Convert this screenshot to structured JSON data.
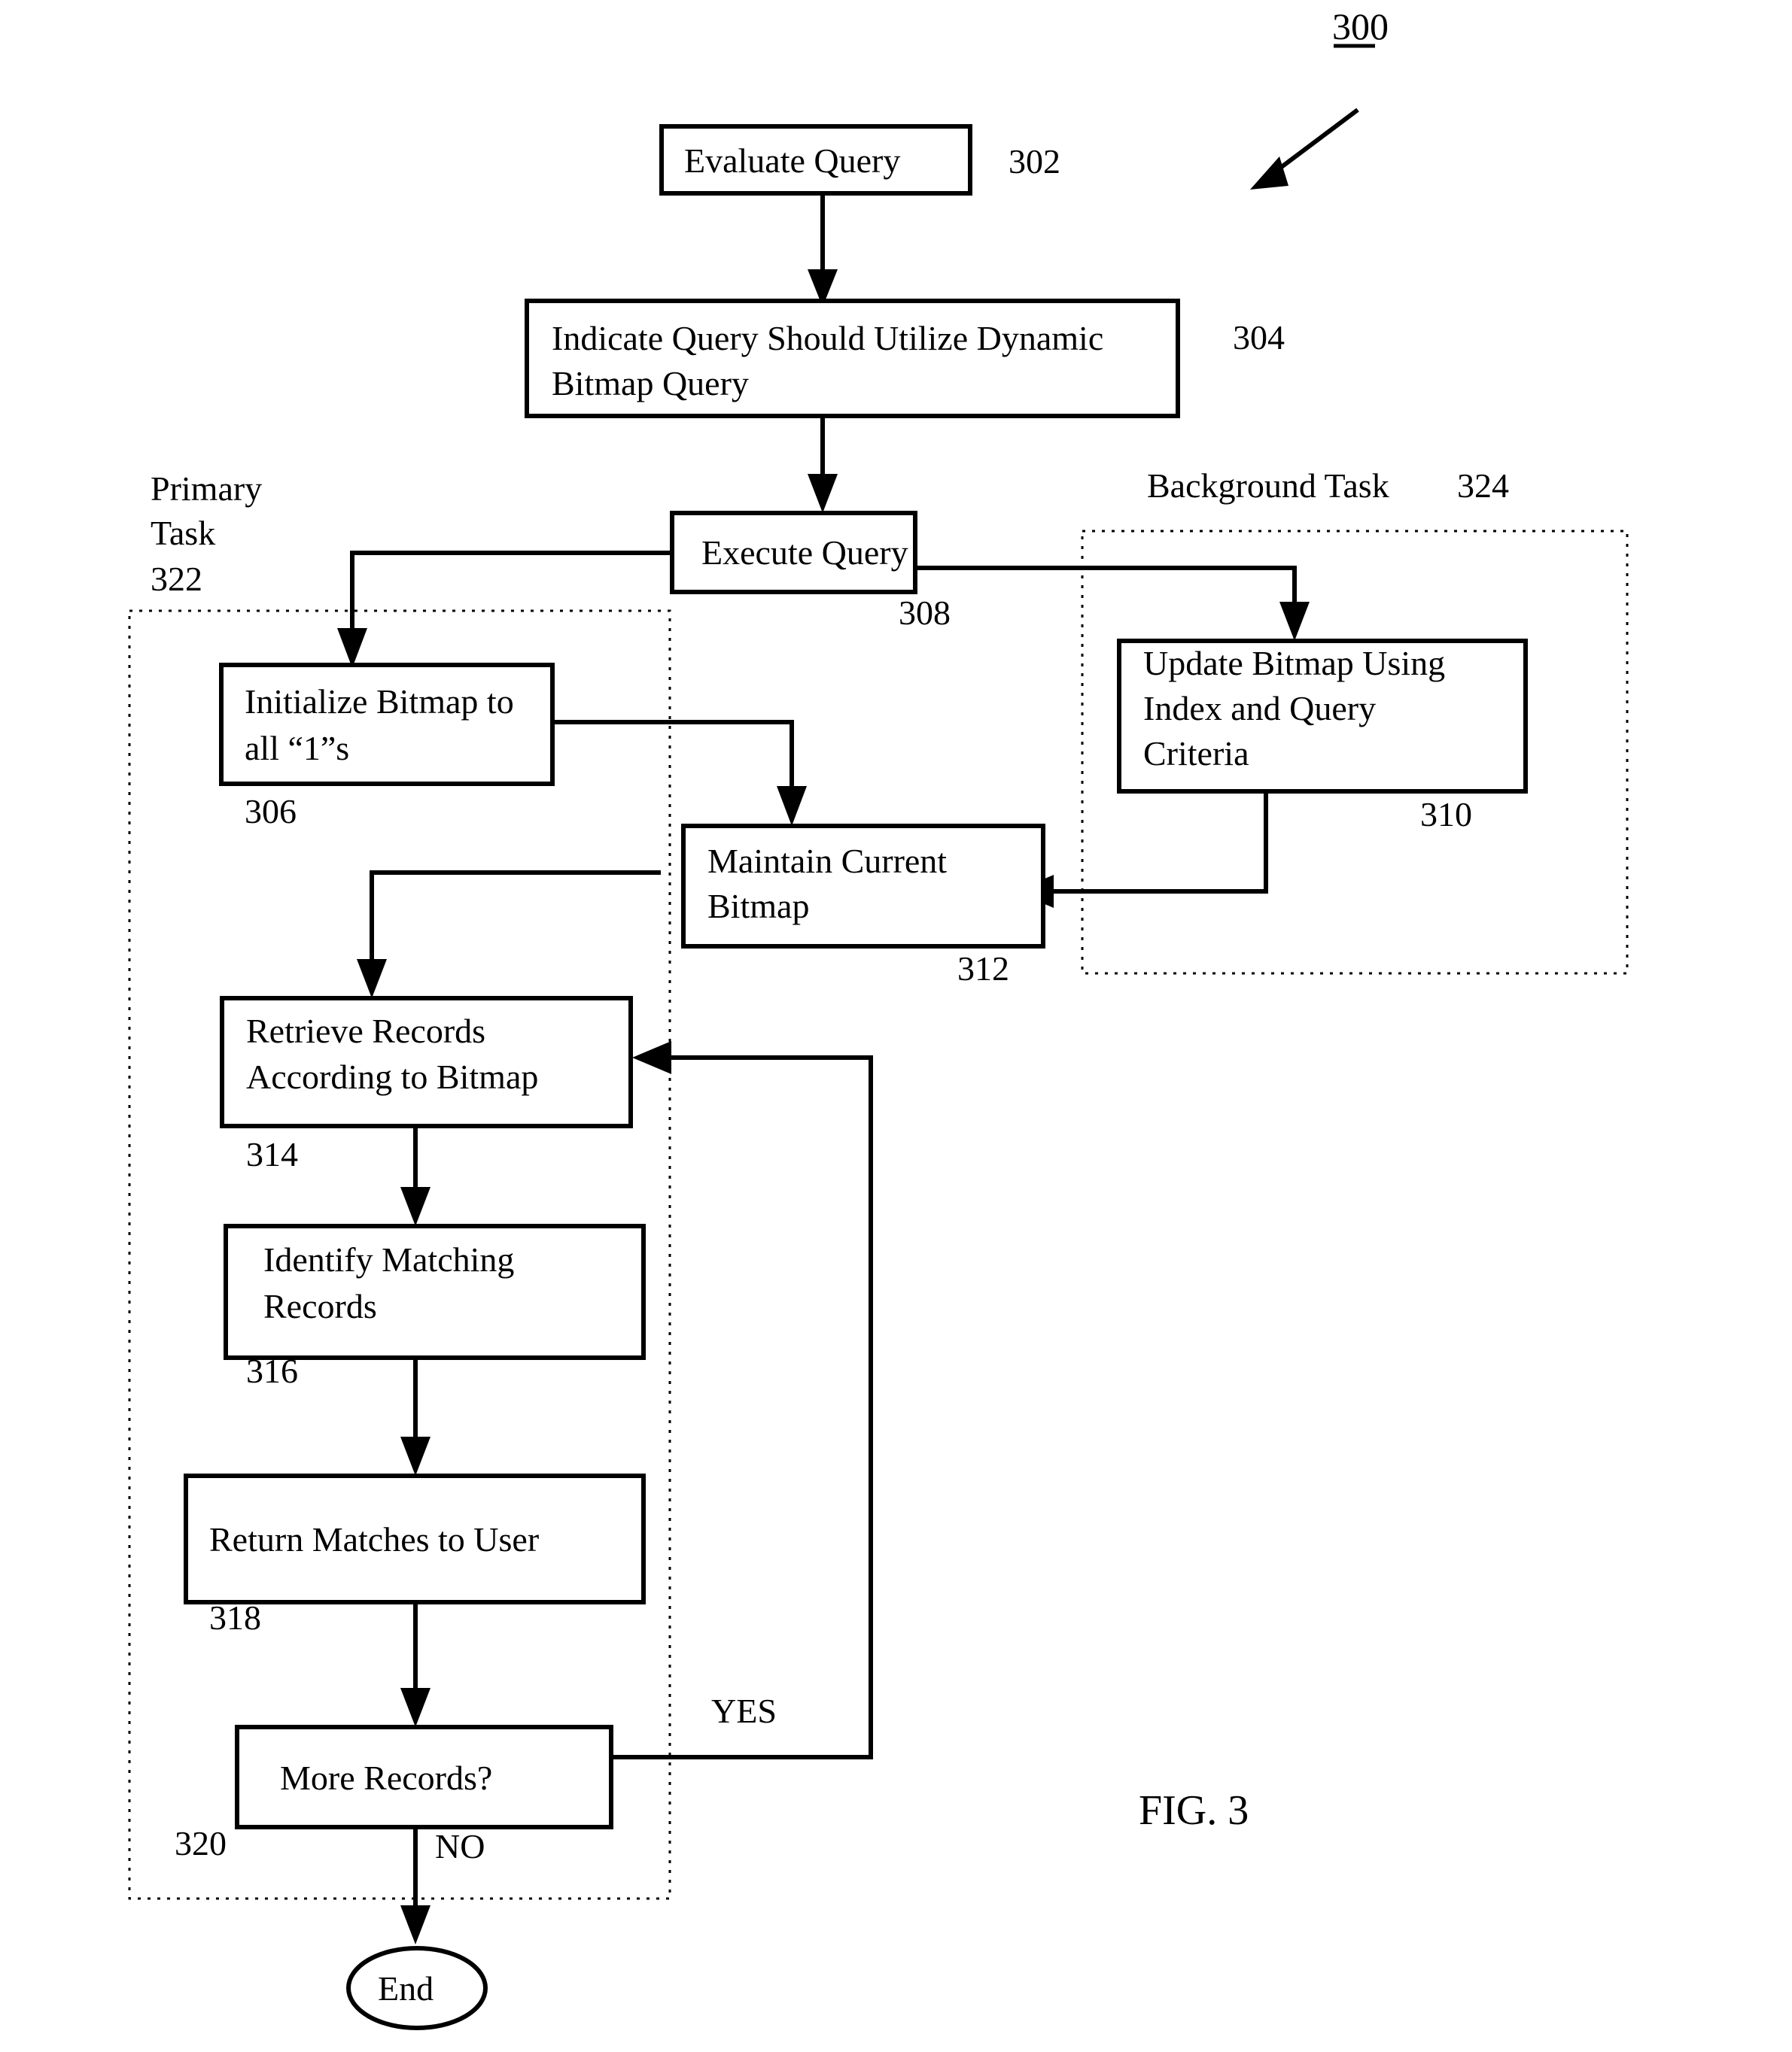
{
  "figure": {
    "id": "300",
    "caption": "FIG. 3",
    "title_ref": "300"
  },
  "groups": [
    {
      "id": "primary-task",
      "label_line1": "Primary",
      "label_line2": "Task",
      "ref": "322"
    },
    {
      "id": "background-task",
      "label": "Background Task",
      "ref": "324"
    }
  ],
  "nodes": [
    {
      "id": "evaluate-query",
      "ref": "302",
      "shape": "process",
      "lines": [
        "Evaluate Query"
      ]
    },
    {
      "id": "indicate-query",
      "ref": "304",
      "shape": "process",
      "lines": [
        "Indicate Query Should Utilize Dynamic",
        "Bitmap Query"
      ]
    },
    {
      "id": "execute-query",
      "ref": "308",
      "shape": "process",
      "lines": [
        "Execute Query"
      ]
    },
    {
      "id": "initialize-bitmap",
      "ref": "306",
      "shape": "process",
      "lines": [
        "Initialize Bitmap to",
        "all “1”s"
      ]
    },
    {
      "id": "update-bitmap",
      "ref": "310",
      "shape": "process",
      "lines": [
        "Update Bitmap Using",
        "Index and Query",
        "Criteria"
      ]
    },
    {
      "id": "maintain-bitmap",
      "ref": "312",
      "shape": "process",
      "lines": [
        "Maintain Current",
        "Bitmap"
      ]
    },
    {
      "id": "retrieve-records",
      "ref": "314",
      "shape": "process",
      "lines": [
        "Retrieve Records",
        "According to Bitmap"
      ]
    },
    {
      "id": "identify-matching",
      "ref": "316",
      "shape": "process",
      "lines": [
        "Identify Matching",
        "Records"
      ]
    },
    {
      "id": "return-matches",
      "ref": "318",
      "shape": "process",
      "lines": [
        "Return Matches to User"
      ]
    },
    {
      "id": "more-records",
      "ref": "320",
      "shape": "decision-rect",
      "lines": [
        "More Records?"
      ]
    },
    {
      "id": "end",
      "ref": "",
      "shape": "terminator",
      "lines": [
        "End"
      ]
    }
  ],
  "branch_labels": {
    "yes": "YES",
    "no": "NO"
  }
}
